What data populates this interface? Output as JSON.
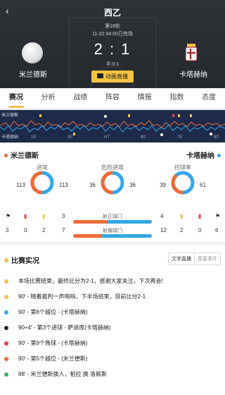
{
  "header": {
    "league": "西乙",
    "round": "第16轮",
    "time": "11-22 04:00已完场",
    "score": "2 : 1",
    "half_score": "半:0:1",
    "live_label": "动画直播",
    "home": "米兰德斯",
    "away": "卡塔赫纳"
  },
  "tabs": [
    "赛况",
    "分析",
    "战绩",
    "阵容",
    "情报",
    "指数",
    "态度"
  ],
  "timeline": {
    "home_label": "米兰德斯",
    "away_label": "卡塔赫纳",
    "ticks": [
      "15'",
      "30'",
      "HT",
      "60'",
      "75'",
      "90'"
    ]
  },
  "stats": {
    "home_name": "米兰德斯",
    "away_name": "卡塔赫纳",
    "rings": [
      {
        "title": "进攻",
        "home": 113,
        "away": 113
      },
      {
        "title": "危险进攻",
        "home": 36,
        "away": 36
      },
      {
        "title": "控球率",
        "home": 39,
        "away": 61
      }
    ],
    "bars": [
      {
        "label": "射正球门",
        "home": 3,
        "away": 4,
        "home_icons": [
          "1",
          "2",
          "3"
        ],
        "away_icons": [
          "1",
          "2",
          "3"
        ]
      },
      {
        "label": "射偏球门",
        "home": 7,
        "away": 12,
        "home_icons": [
          "3",
          "0",
          "2"
        ],
        "away_icons": [
          "2",
          "0",
          "6"
        ]
      }
    ]
  },
  "events": {
    "title": "比赛实况",
    "btn_text": "文字直播",
    "btn_events": "重要事件",
    "items": [
      "本场比赛结束，最终比分为2-1，感谢大家关注，下次再会!",
      "90' - 随着裁判一声哨响，下半场结束，目前比分2-1",
      "90' - 第6个越位 - (卡塔赫纳)",
      "90+4' - 第3个进球 - 萨迪库(卡塔赫纳)",
      "90' - 第9个角球 - (卡塔赫纳)",
      "90' - 第5个越位 - (米兰德斯)",
      "88' - 米兰德斯换人，帕拉 换 洛佩斯"
    ]
  }
}
